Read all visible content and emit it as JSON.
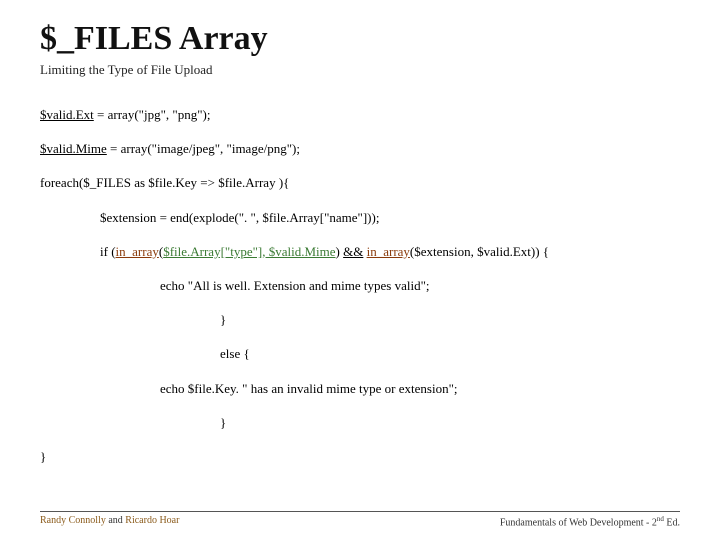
{
  "title": "$_FILES Array",
  "subtitle": "Limiting the Type of File Upload",
  "code": {
    "l1a": "$valid.Ext",
    "l1b": " = array(\"jpg\", \"png\");",
    "l2a": "$valid.Mime",
    "l2b": " = array(\"image/jpeg\", \"image/png\");",
    "l3": "foreach($_FILES as $file.Key => $file.Array ){",
    "l4": "$extension = end(explode(\". \", $file.Array[\"name\"]));",
    "l5a": "if (",
    "l5b": "in_array",
    "l5c": "(",
    "l5d": "$file.Array[\"type\"], $valid.Mime",
    "l5e": ") ",
    "l5f": "&&",
    "l5g": " ",
    "l5h": "in_array",
    "l5i": "($extension, $valid.Ext)) {",
    "l6": "echo \"All is well. Extension and mime types valid\";",
    "l7": "}",
    "l8": "else {",
    "l9": "echo $file.Key. \" has an invalid mime type or extension\";",
    "l10": "}",
    "l11": "}"
  },
  "footer": {
    "left_a": "Randy Connolly",
    "left_mid": " and ",
    "left_b": "Ricardo Hoar",
    "right_a": "Fundamentals of Web Development - 2",
    "right_sup": "nd",
    "right_b": " Ed."
  }
}
